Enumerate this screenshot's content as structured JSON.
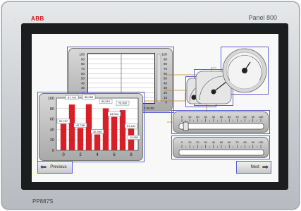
{
  "device": {
    "brand": "ABB",
    "panel_title": "Panel 800",
    "model": "PP887S"
  },
  "trend": {
    "y_ticks": [
      "100",
      "90",
      "80",
      "70",
      "60",
      "50",
      "40",
      "30",
      "20",
      "10",
      "0"
    ],
    "time_label": "12:00:00"
  },
  "bar_chart": {
    "chart_data": {
      "type": "bar",
      "categories": [
        "0",
        "1",
        "2",
        "3",
        "4",
        "5",
        "6",
        "7",
        "8"
      ],
      "values": [
        50.7,
        87.7,
        42.7,
        88.3,
        30.4,
        80.5,
        64.0,
        76.9,
        41.4
      ],
      "data_labels": [
        "50,767",
        "87,703",
        "42,788",
        "88,283",
        "30,394",
        "80,519",
        "64,004",
        "76,900",
        "41,441"
      ],
      "extra_label": "12,950",
      "y_ticks": [
        "100",
        "80",
        "60",
        "40",
        "20",
        "0"
      ],
      "x_ticks": [
        "0",
        "2",
        "4",
        "6",
        "8"
      ],
      "ylim": [
        0,
        100
      ],
      "bar_color": "#d61f26"
    }
  },
  "slider": {
    "ticks": [
      "0",
      "10",
      "20",
      "30",
      "40",
      "50",
      "60",
      "70",
      "80",
      "90",
      "100"
    ],
    "value": 5
  },
  "bar_scale": {
    "ticks": [
      "0",
      "10",
      "20",
      "30",
      "40",
      "50",
      "60",
      "70",
      "80",
      "90",
      "100"
    ]
  },
  "gauges": {
    "gauge_1_level": 0.45,
    "gauge_2_level": 0.6,
    "gauge_3_level": 0.55
  },
  "navigation": {
    "previous_label": "Previous",
    "next_label": "Next"
  },
  "colors": {
    "accent": "#5c64d0",
    "brand": "#d8141b"
  }
}
